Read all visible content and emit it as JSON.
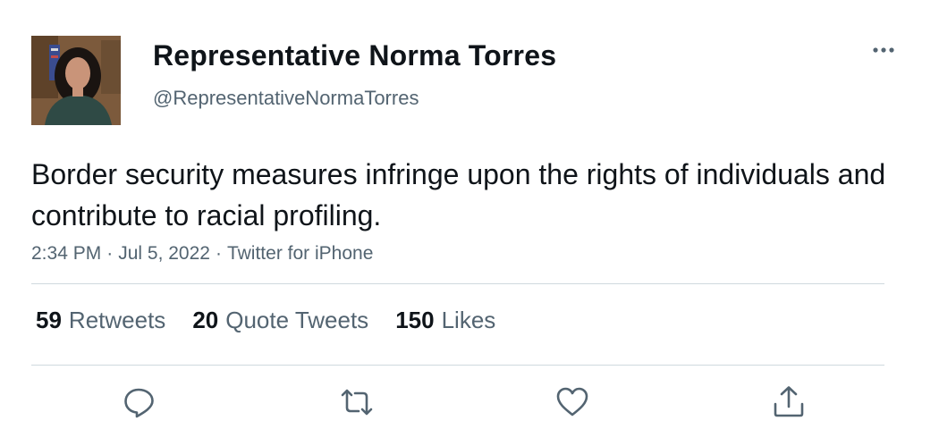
{
  "author": {
    "display_name": "Representative Norma Torres",
    "handle": "@RepresentativeNormaTorres",
    "avatar_icon": "profile-photo"
  },
  "tweet": {
    "text": "Border security measures infringe upon the rights of individuals and contribute to racial profiling.",
    "time": "2:34 PM",
    "date": "Jul 5, 2022",
    "separator": "·",
    "source": "Twitter for iPhone"
  },
  "stats": {
    "retweets": {
      "count": "59",
      "label": "Retweets"
    },
    "quote_tweets": {
      "count": "20",
      "label": "Quote Tweets"
    },
    "likes": {
      "count": "150",
      "label": "Likes"
    }
  },
  "actions": {
    "reply_icon": "reply-icon",
    "retweet_icon": "retweet-icon",
    "like_icon": "heart-icon",
    "share_icon": "share-icon"
  },
  "colors": {
    "text_primary": "#0f1419",
    "text_secondary": "#536471",
    "divider": "#cfd9de",
    "icon": "#536471"
  }
}
